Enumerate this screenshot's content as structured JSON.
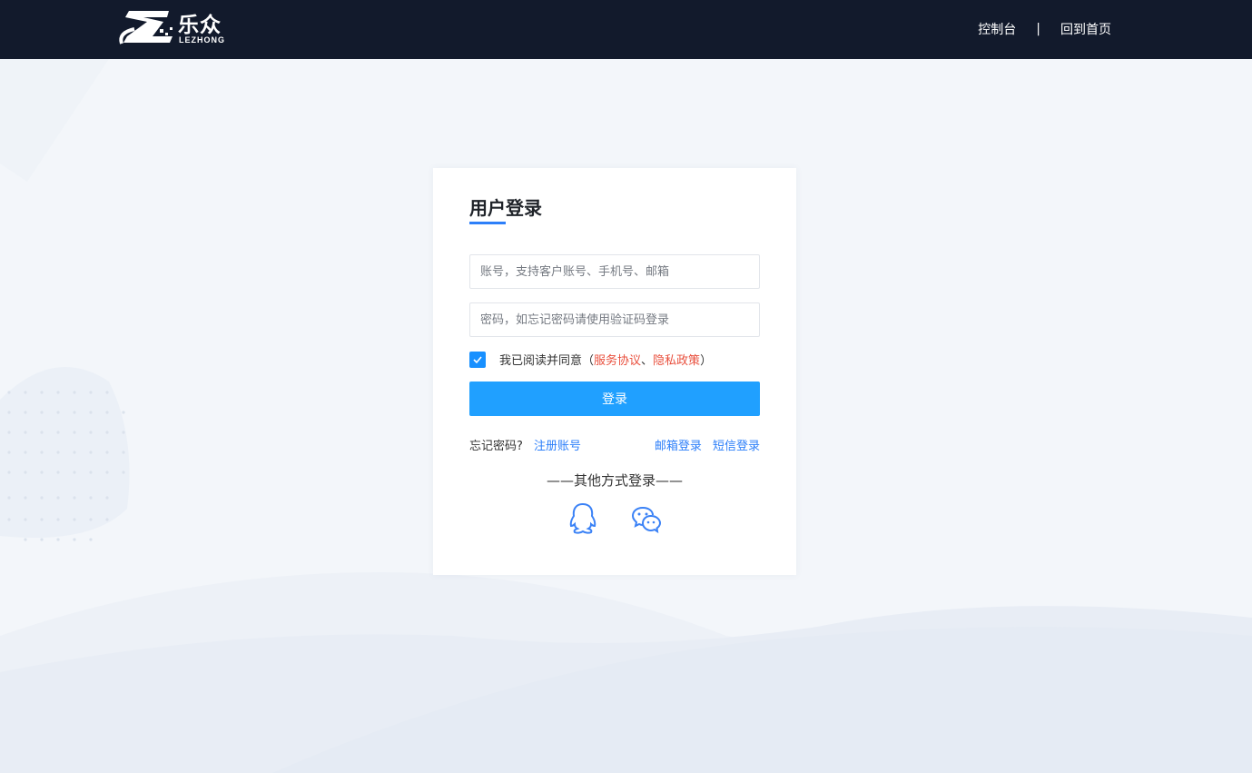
{
  "header": {
    "logo_text": "乐众",
    "logo_subtext": "LEZHONG",
    "nav": {
      "console": "控制台",
      "separator": "|",
      "home": "回到首页"
    }
  },
  "login": {
    "title": "用户登录",
    "account_placeholder": "账号，支持客户账号、手机号、邮箱",
    "password_placeholder": "密码，如忘记密码请使用验证码登录",
    "agree": {
      "checked": true,
      "text": "我已阅读并同意（",
      "service_link": "服务协议",
      "comma": "、",
      "privacy_link": "隐私政策",
      "close": "）"
    },
    "submit_label": "登录",
    "forgot": "忘记密码?",
    "register": "注册账号",
    "email_login": "邮箱登录",
    "sms_login": "短信登录",
    "other_methods": "——其他方式登录——",
    "socials": [
      {
        "icon": "qq-icon"
      },
      {
        "icon": "wechat-icon"
      }
    ]
  },
  "colors": {
    "header_bg": "#121a2c",
    "primary": "#20a0ff",
    "link": "#2d7ff9",
    "policy_link": "#e9503e",
    "page_bg": "#f3f6fa"
  }
}
